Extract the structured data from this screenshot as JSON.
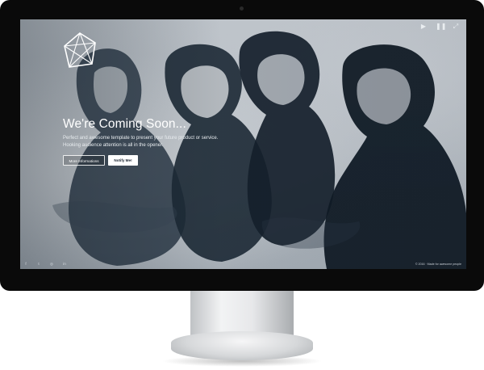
{
  "hero": {
    "headline": "We're Coming Soon...",
    "sub_line1": "Perfect and awesome template to present your future product or service.",
    "sub_line2": "Hooking audience attention is all in the opener."
  },
  "buttons": {
    "more_info": "More Informations",
    "notify": "Notify Me!"
  },
  "media_controls": [
    {
      "icon": "play-icon",
      "glyph": "▶"
    },
    {
      "icon": "pause-icon",
      "glyph": "❚❚"
    },
    {
      "icon": "fullscreen-icon",
      "glyph": "⤢"
    }
  ],
  "social": [
    {
      "icon": "facebook-icon",
      "glyph": "f"
    },
    {
      "icon": "twitter-icon",
      "glyph": "t"
    },
    {
      "icon": "instagram-icon",
      "glyph": "◎"
    },
    {
      "icon": "linkedin-icon",
      "glyph": "in"
    }
  ],
  "footer": {
    "copyright": "© 2016 · Made for awesome people"
  },
  "colors": {
    "screen_bg": "#b9c0c7",
    "ink": "#16212c",
    "bezel": "#0a0a0a"
  }
}
